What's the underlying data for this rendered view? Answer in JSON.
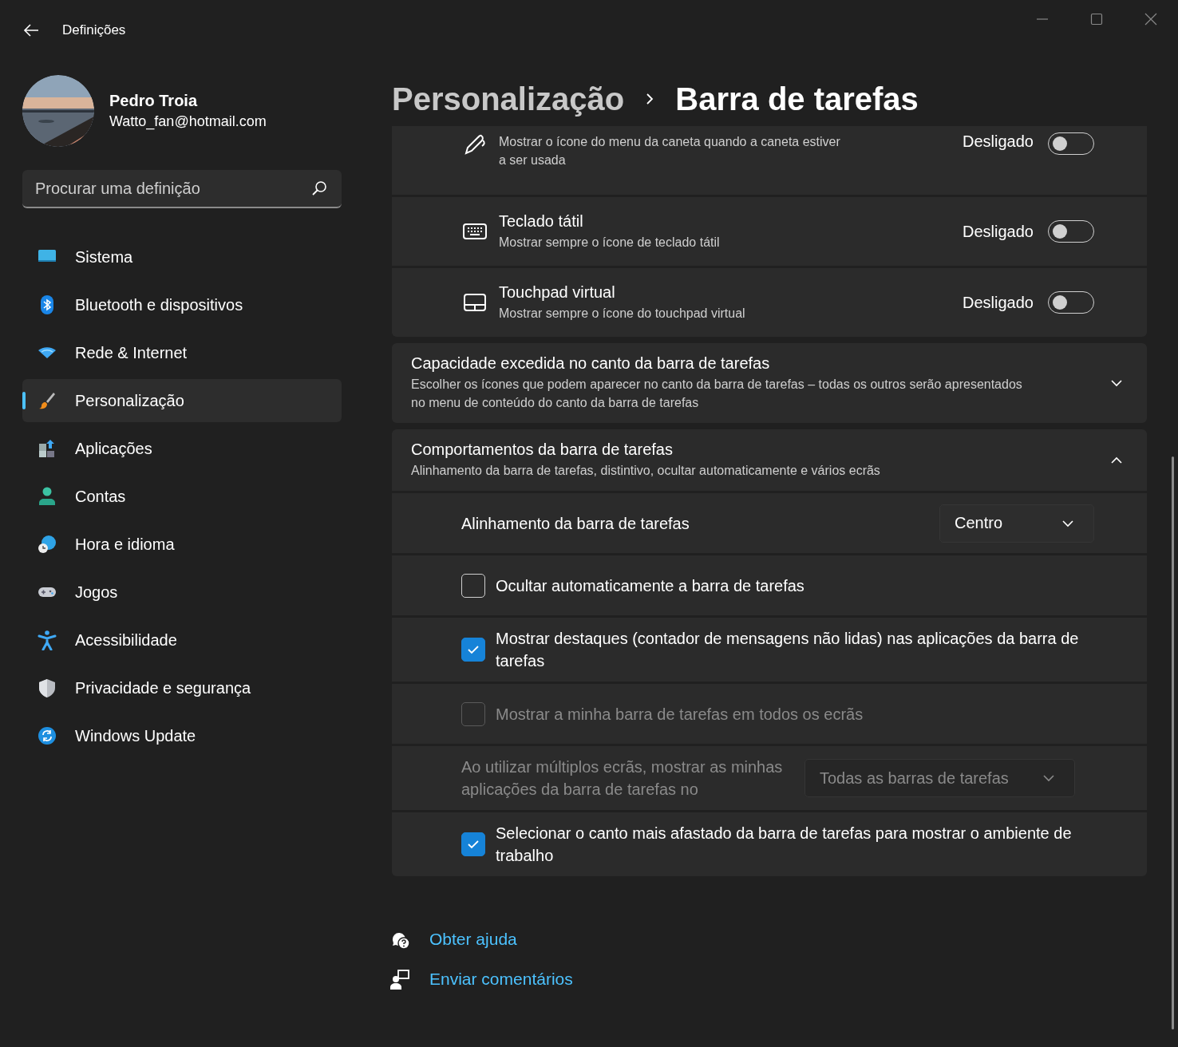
{
  "window": {
    "title": "Definições"
  },
  "user": {
    "name": "Pedro Troia",
    "email": "Watto_fan@hotmail.com"
  },
  "search": {
    "placeholder": "Procurar uma definição"
  },
  "nav": [
    {
      "label": "Sistema",
      "selected": false
    },
    {
      "label": "Bluetooth e dispositivos",
      "selected": false
    },
    {
      "label": "Rede & Internet",
      "selected": false
    },
    {
      "label": "Personalização",
      "selected": true
    },
    {
      "label": "Aplicações",
      "selected": false
    },
    {
      "label": "Contas",
      "selected": false
    },
    {
      "label": "Hora e idioma",
      "selected": false
    },
    {
      "label": "Jogos",
      "selected": false
    },
    {
      "label": "Acessibilidade",
      "selected": false
    },
    {
      "label": "Privacidade e segurança",
      "selected": false
    },
    {
      "label": "Windows Update",
      "selected": false
    }
  ],
  "breadcrumb": {
    "parent": "Personalização",
    "current": "Barra de tarefas"
  },
  "toggle_rows": [
    {
      "description": "Mostrar o ícone do menu da caneta quando a caneta estiver a ser usada",
      "state_label": "Desligado",
      "on": false
    },
    {
      "title": "Teclado tátil",
      "description": "Mostrar sempre o ícone de teclado tátil",
      "state_label": "Desligado",
      "on": false
    },
    {
      "title": "Touchpad virtual",
      "description": "Mostrar sempre o ícone do touchpad virtual",
      "state_label": "Desligado",
      "on": false
    }
  ],
  "corner_overflow": {
    "title": "Capacidade excedida no canto da barra de tarefas",
    "description": "Escolher os ícones que podem aparecer no canto da barra de tarefas – todas os outros serão apresentados no menu de conteúdo do canto da barra de tarefas",
    "expanded": false
  },
  "behaviors": {
    "title": "Comportamentos da barra de tarefas",
    "description": "Alinhamento da barra de tarefas, distintivo, ocultar automaticamente e vários ecrãs",
    "expanded": true,
    "settings": [
      {
        "kind": "dropdown",
        "label": "Alinhamento da barra de tarefas",
        "value": "Centro",
        "disabled": false
      },
      {
        "kind": "checkbox",
        "label": "Ocultar automaticamente a barra de tarefas",
        "checked": false,
        "disabled": false
      },
      {
        "kind": "checkbox",
        "label": "Mostrar destaques (contador de mensagens não lidas) nas aplicações da barra de tarefas",
        "checked": true,
        "disabled": false
      },
      {
        "kind": "checkbox",
        "label": "Mostrar a minha barra de tarefas em todos os ecrãs",
        "checked": false,
        "disabled": true
      },
      {
        "kind": "dropdown",
        "label": "Ao utilizar múltiplos ecrãs, mostrar as minhas aplicações da barra de tarefas no",
        "value": "Todas as barras de tarefas",
        "disabled": true
      },
      {
        "kind": "checkbox",
        "label": "Selecionar o canto mais afastado da barra de tarefas para mostrar o ambiente de trabalho",
        "checked": true,
        "disabled": false
      }
    ]
  },
  "links": [
    {
      "label": "Obter ajuda"
    },
    {
      "label": "Enviar comentários"
    }
  ]
}
